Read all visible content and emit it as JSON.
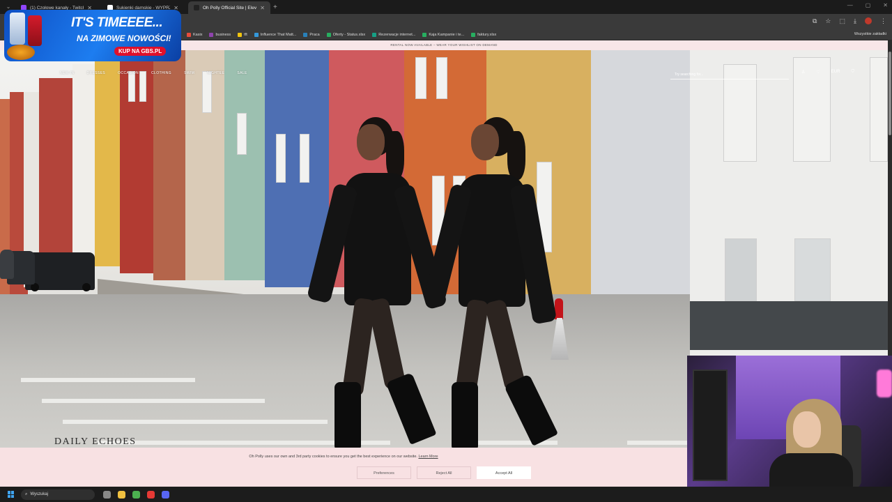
{
  "browser": {
    "tabs": [
      {
        "title": "(1) Czołowe kanały - Twitch",
        "favicon_color": "#9146ff",
        "active": false
      },
      {
        "title": "Sukienki damskie - WYPRZEDAŻ",
        "favicon_color": "#ffffff",
        "active": false
      },
      {
        "title": "Oh Polly Official Site | Elevate",
        "favicon_color": "#222222",
        "active": true
      }
    ],
    "new_tab": "+",
    "bookmarks": [
      {
        "label": "Kasix",
        "color": "#e74c3c"
      },
      {
        "label": "business",
        "color": "#8e44ad"
      },
      {
        "label": "tft",
        "color": "#f1c40f"
      },
      {
        "label": "Influence That Matt...",
        "color": "#3498db"
      },
      {
        "label": "Praca",
        "color": "#2980b9"
      },
      {
        "label": "Oferty - Status.xlsx",
        "color": "#27ae60"
      },
      {
        "label": "Rezerwacje internet...",
        "color": "#16a085"
      },
      {
        "label": "Kaja Kampanie i te...",
        "color": "#27ae60"
      },
      {
        "label": "faktury.xlsx",
        "color": "#27ae60"
      }
    ],
    "all_bookmarks": "Wszystkie zakładki"
  },
  "promo_overlay": {
    "line1": "IT'S TIMEEEE...",
    "line2": "NA ZIMOWE NOWOŚCI!",
    "line3": "KUP NA GBS.PL"
  },
  "site": {
    "announcement": "RENTAL NOW AVAILABLE – WEAR YOUR WISHLIST ON DEMAND",
    "nav": [
      "NEW IN",
      "DRESSES",
      "OCCASION",
      "CLOTHING",
      "SWIM",
      "NIGHTEE",
      "SALE"
    ],
    "search_placeholder": "Try searching for...",
    "currency": "EUR",
    "collection_logo": "DAILY ECHOES",
    "cookie": {
      "message": "Oh Polly uses our own and 3rd party cookies to ensure you get the best experience on our website.",
      "learn_more": "Learn More",
      "preferences": "Preferences",
      "reject": "Reject All",
      "accept": "Accept All"
    }
  },
  "taskbar": {
    "search_label": "Wyszukaj",
    "apps": [
      {
        "name": "task-view",
        "color": "#888888"
      },
      {
        "name": "file-explorer",
        "color": "#f0c040"
      },
      {
        "name": "chrome",
        "color": "#4caf50"
      },
      {
        "name": "opera",
        "color": "#e53935"
      },
      {
        "name": "discord",
        "color": "#5865f2"
      }
    ]
  }
}
